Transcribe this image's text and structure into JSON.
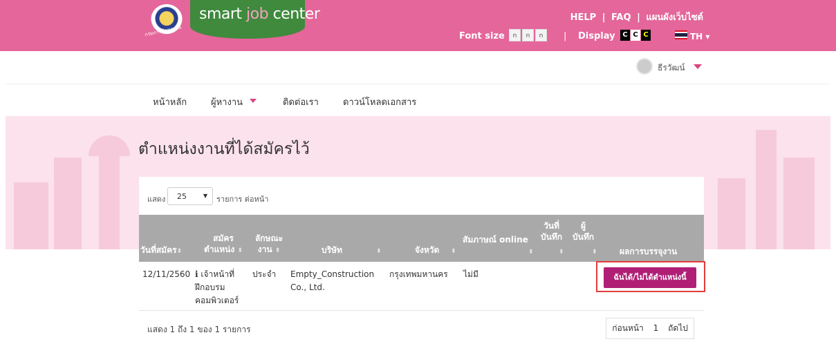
{
  "header": {
    "logo_part1": "smart ",
    "logo_part2": "job",
    "logo_part3": " center",
    "seal_text": "กรมการจัดหางาน",
    "links": [
      "HELP",
      "FAQ",
      "แผนผังเว็บไซต์"
    ],
    "link_sep": "|",
    "font_size_label": "Font size",
    "font_sizes": [
      "n",
      "n",
      "n"
    ],
    "display_label": "Display",
    "display_modes": [
      "C",
      "C",
      "C"
    ],
    "language": "TH ▾",
    "colors": {
      "header_bg": "#e4669a",
      "logo_bg": "#3f8a3d",
      "accent": "#b01f75"
    }
  },
  "user": {
    "name": "ธีรวัฒน์"
  },
  "nav": {
    "home": "หน้าหลัก",
    "job_seeker": "ผู้หางาน",
    "contact": "ติดต่อเรา",
    "download": "ดาวน์โหลดเอกสาร"
  },
  "page": {
    "title": "ตำแหน่งงานที่ได้สมัครไว้"
  },
  "table": {
    "length_prefix": "แสดง",
    "length_value": "25",
    "length_suffix": "รายการ ต่อหน้า",
    "columns": {
      "apply_date": "วันที่สมัคร",
      "position_1": "สมัคร",
      "position_2": "ตำแหน่ง",
      "job_type_1": "ลักษณะ",
      "job_type_2": "งาน",
      "company": "บริษัท",
      "province": "จังหวัด",
      "interview": "สัมภาษณ์ online",
      "record_date_1": "วันที่",
      "record_date_2": "บันทึก",
      "recorder_1": "ผู้",
      "recorder_2": "บันทึก",
      "result": "ผลการบรรจุงาน"
    },
    "rows": [
      {
        "apply_date": "12/11/2560",
        "info_icon": "i",
        "position_line1": "เจ้าหน้าที่",
        "position_line2": "ฝึกอบรม",
        "position_line3": "คอมพิวเตอร์",
        "job_type": "ประจำ",
        "company_line1": "Empty_Construction",
        "company_line2": "Co., Ltd.",
        "province": "กรุงเทพมหานคร",
        "interview": "ไม่มี",
        "result_button": "ฉันได้/ไม่ได้ตำแหน่งนี้"
      }
    ],
    "info": "แสดง 1 ถึง 1 ของ 1 รายการ",
    "pagination": {
      "prev": "ก่อนหน้า",
      "page": "1",
      "next": "ถัดไป"
    }
  }
}
